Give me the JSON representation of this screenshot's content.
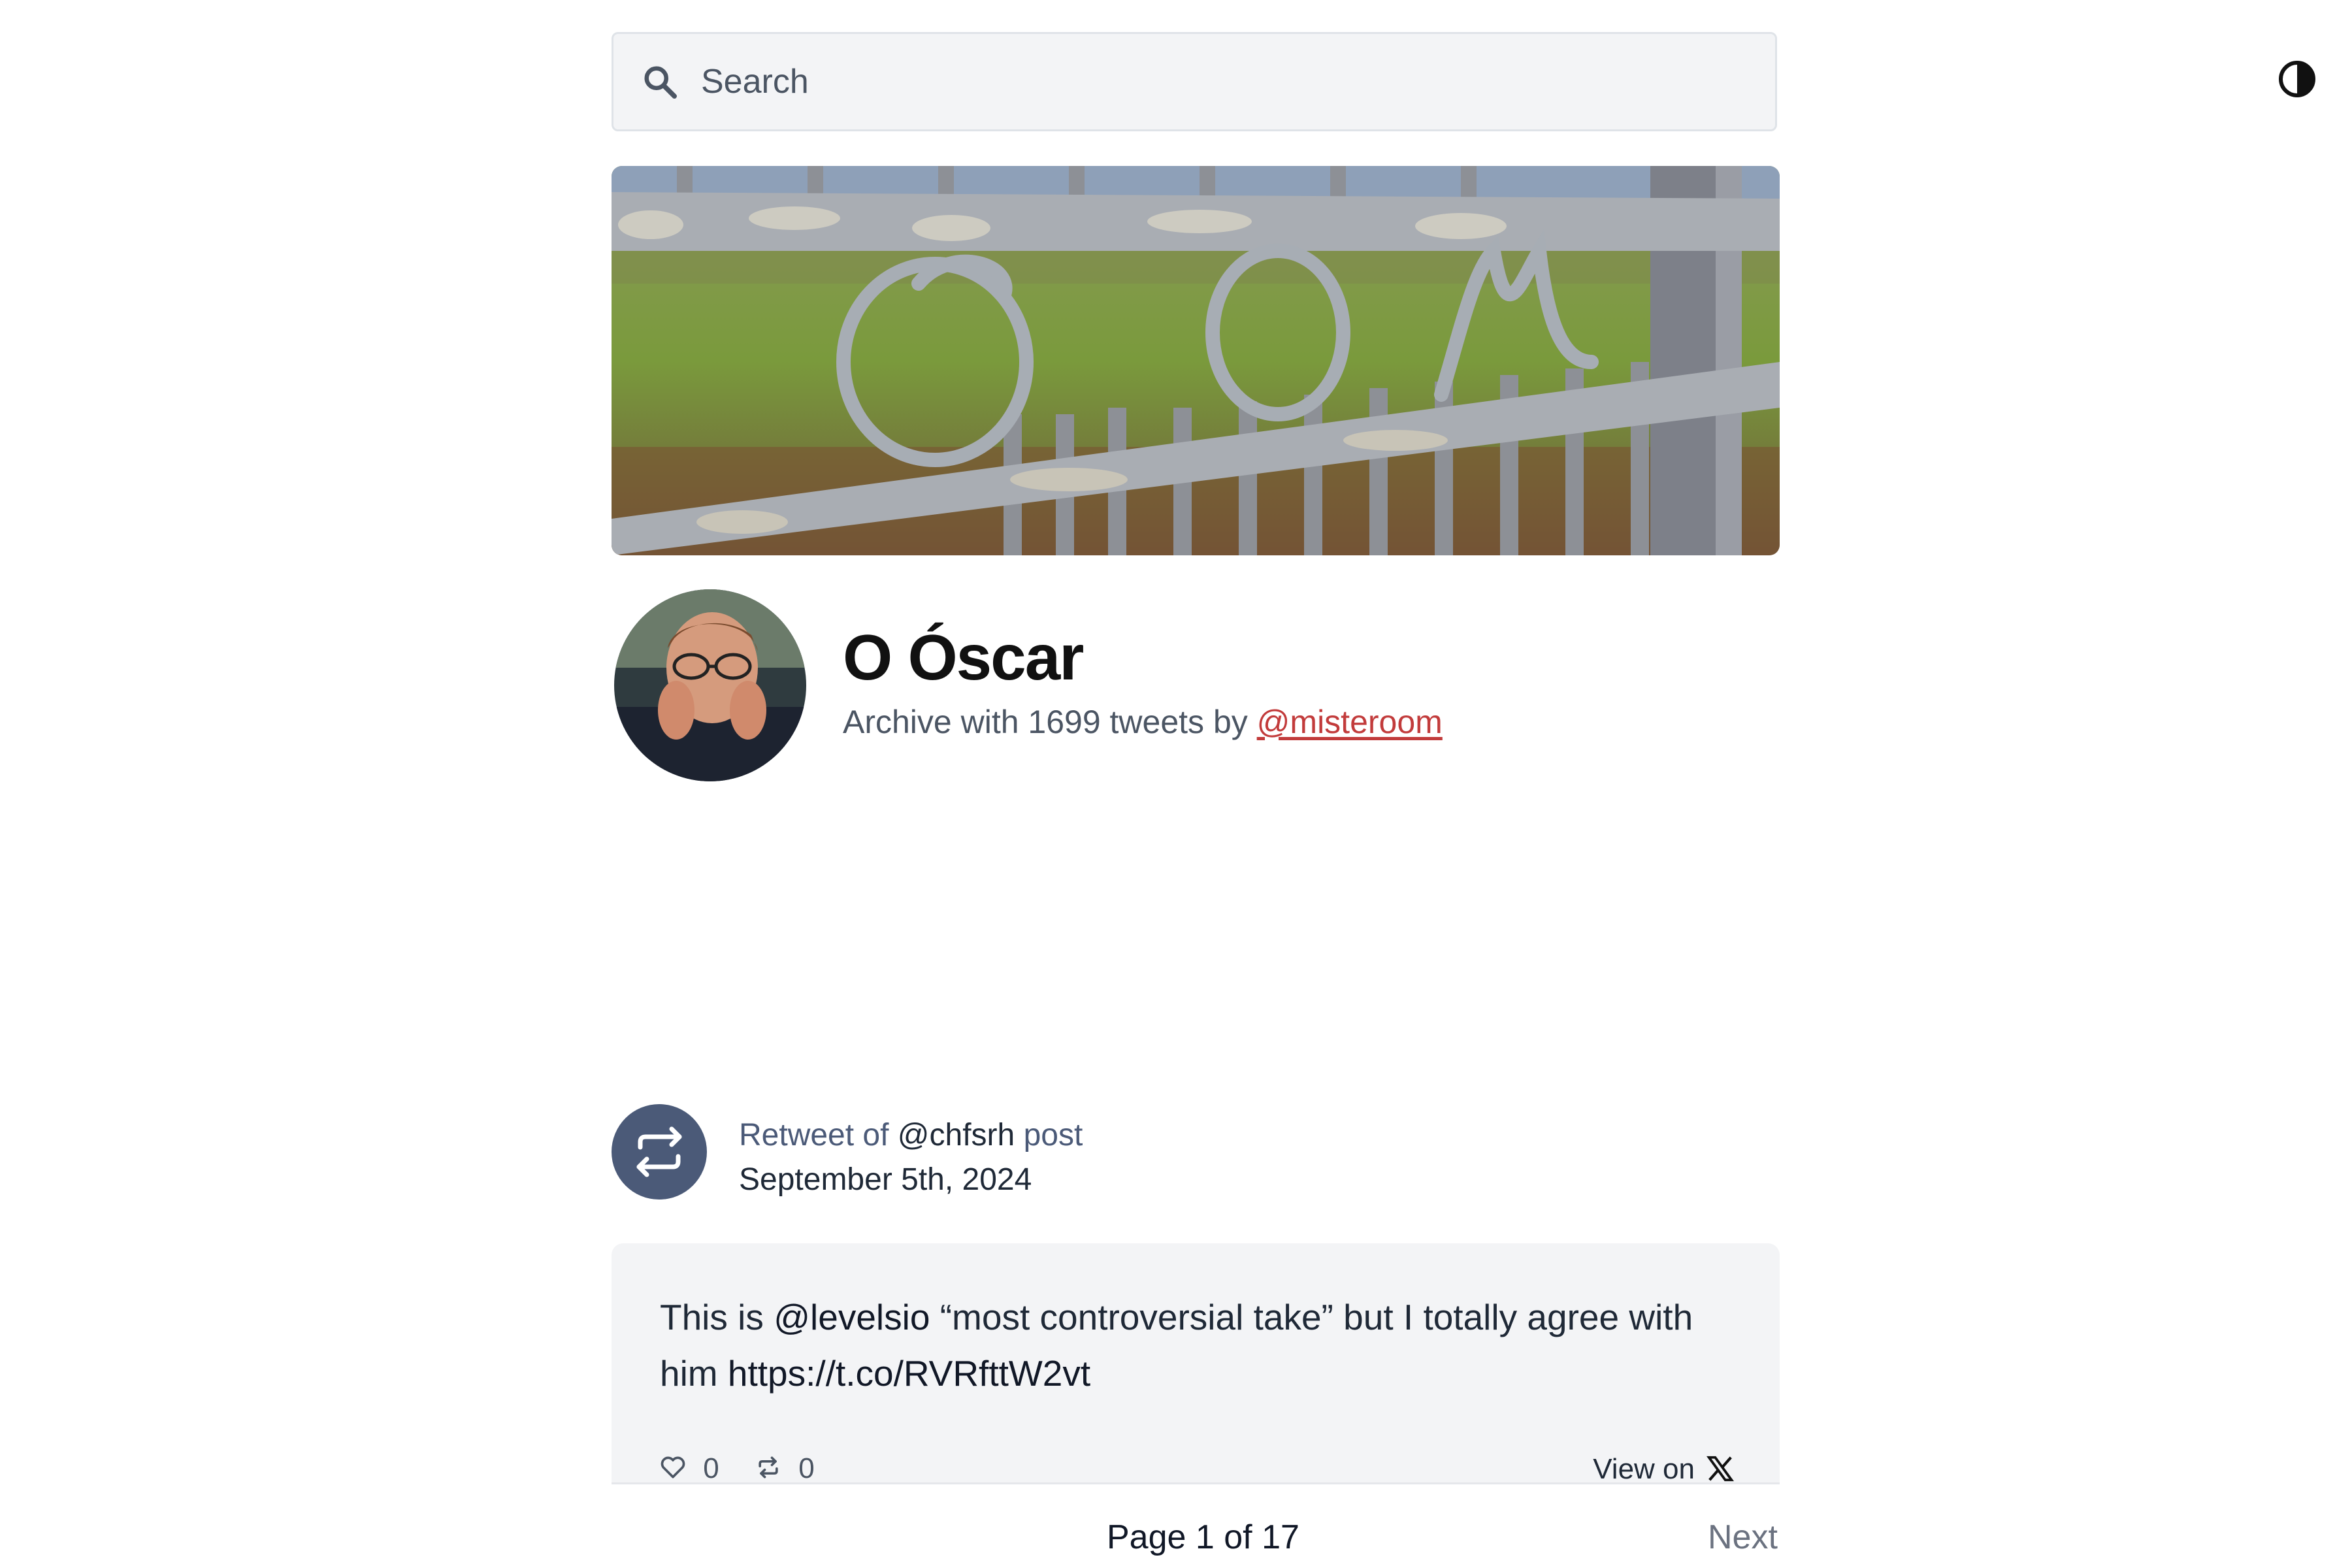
{
  "search": {
    "placeholder": "Search"
  },
  "profile": {
    "name": "O Óscar",
    "subtitle_prefix": "Archive with 1699 tweets by ",
    "handle": "@misteroom"
  },
  "tweet": {
    "rt_prefix": "Retweet of ",
    "rt_handle": "@chfsrh",
    "rt_suffix": " post",
    "date": "September 5th, 2024",
    "text_a": "This is ",
    "text_mention": "@levelsio",
    "text_b": " “most controversial take” but I totally agree with him ",
    "text_link": "https://t.co/RVRfttW2vt",
    "likes": "0",
    "retweets": "0",
    "view_on": "View on"
  },
  "pagination": {
    "label": "Page 1 of 17",
    "next": "Next"
  },
  "icons": [
    "search-icon",
    "contrast-icon",
    "retweet-icon",
    "heart-icon",
    "x-logo-icon"
  ],
  "colors": {
    "accent_link": "#c23b3b",
    "retweet_circle": "#4b5a78",
    "card_bg": "#f3f4f6"
  }
}
